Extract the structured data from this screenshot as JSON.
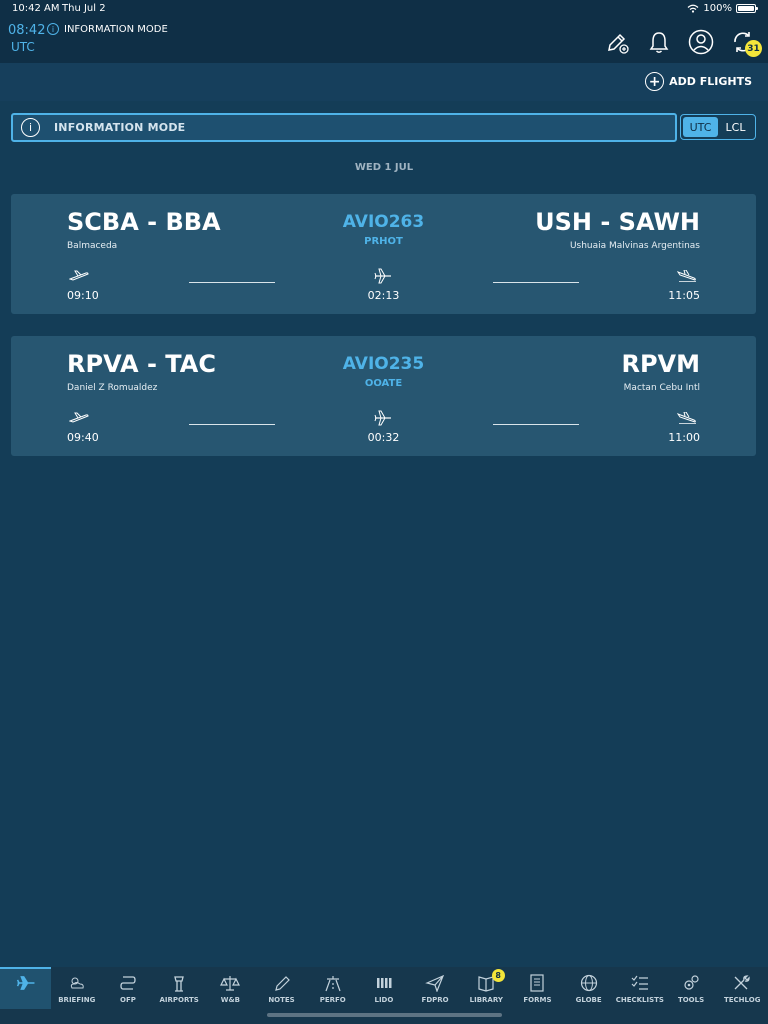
{
  "status_bar": {
    "time": "10:42 AM",
    "date": "Thu Jul 2",
    "battery": "100%"
  },
  "header": {
    "clock_time": "08:42",
    "clock_zone": "UTC",
    "mode_label": "INFORMATION MODE",
    "sync_badge": "31",
    "icons": [
      "edit-pen-plus-icon",
      "bell-icon",
      "user-icon",
      "sync-icon"
    ]
  },
  "toolbar": {
    "add_flights_label": "ADD FLIGHTS"
  },
  "info_bar": {
    "label": "INFORMATION MODE",
    "icon_glyph": "i"
  },
  "timezone_toggle": {
    "options": [
      "UTC",
      "LCL"
    ],
    "selected": "UTC"
  },
  "date_header": "WED 1 JUL",
  "flights": [
    {
      "origin": "SCBA - BBA",
      "origin_name": "Balmaceda",
      "flight_number": "AVIO263",
      "registration": "PRHOT",
      "destination": "USH - SAWH",
      "destination_name": "Ushuaia Malvinas Argentinas",
      "departure_time": "09:10",
      "duration": "02:13",
      "arrival_time": "11:05"
    },
    {
      "origin": "RPVA - TAC",
      "origin_name": "Daniel Z Romualdez",
      "flight_number": "AVIO235",
      "registration": "OOATE",
      "destination": "RPVM",
      "destination_name": "Mactan Cebu Intl",
      "departure_time": "09:40",
      "duration": "00:32",
      "arrival_time": "11:00"
    }
  ],
  "tabs": [
    {
      "label": "",
      "icon": "airplane-icon",
      "active": true
    },
    {
      "label": "BRIEFING",
      "icon": "weather-icon"
    },
    {
      "label": "OFP",
      "icon": "route-icon"
    },
    {
      "label": "AIRPORTS",
      "icon": "tower-icon"
    },
    {
      "label": "W&B",
      "icon": "scale-icon"
    },
    {
      "label": "NOTES",
      "icon": "pencil-icon"
    },
    {
      "label": "PERFO",
      "icon": "runway-icon"
    },
    {
      "label": "LIDO",
      "icon": "bars-icon"
    },
    {
      "label": "FDPRO",
      "icon": "send-icon"
    },
    {
      "label": "LIBRARY",
      "icon": "book-icon",
      "badge": "8"
    },
    {
      "label": "FORMS",
      "icon": "form-icon"
    },
    {
      "label": "GLOBE",
      "icon": "globe-icon"
    },
    {
      "label": "CHECKLISTS",
      "icon": "checklist-icon"
    },
    {
      "label": "TOOLS",
      "icon": "gears-icon"
    },
    {
      "label": "TECHLOG",
      "icon": "wrench-icon"
    }
  ],
  "colors": {
    "background": "#143d57",
    "accent": "#4fb3e8",
    "card": "#275671",
    "badge": "#f3e53a"
  }
}
